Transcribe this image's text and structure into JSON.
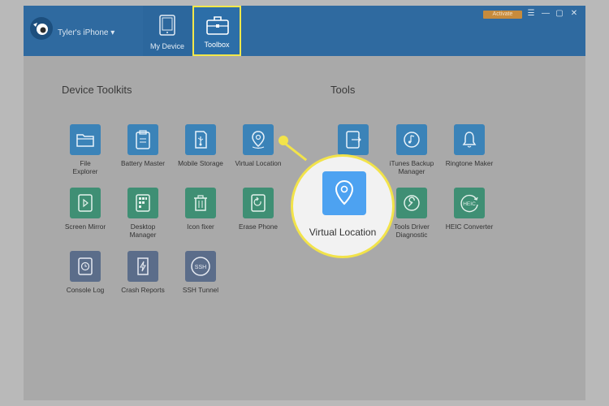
{
  "header": {
    "device_name": "Tyler's iPhone ▾",
    "tabs": [
      {
        "label": "My Device",
        "icon": "tablet-icon"
      },
      {
        "label": "Toolbox",
        "icon": "briefcase-icon",
        "selected": true,
        "highlight_color": "#f2e84a"
      }
    ],
    "activate_label": "Activate",
    "window_controls": {
      "menu": "☰",
      "minimize": "—",
      "maximize": "▢",
      "close": "✕"
    },
    "bg_color": "#2f6aa0"
  },
  "sections": {
    "device_toolkits": "Device Toolkits",
    "tools": "Tools"
  },
  "device_toolkits": [
    {
      "label": "File Explorer",
      "icon": "folder-icon",
      "color": "blue"
    },
    {
      "label": "Battery Master",
      "icon": "clipboard-icon",
      "color": "blue"
    },
    {
      "label": "Mobile Storage",
      "icon": "usb-icon",
      "color": "blue"
    },
    {
      "label": "Virtual Location",
      "icon": "location-pin-icon",
      "color": "blue"
    },
    {
      "label": "Screen Mirror",
      "icon": "play-icon",
      "color": "green"
    },
    {
      "label": "Desktop Manager",
      "icon": "grid-icon",
      "color": "green"
    },
    {
      "label": "Icon fixer",
      "icon": "trash-icon",
      "color": "green"
    },
    {
      "label": "Erase Phone",
      "icon": "phone-reset-icon",
      "color": "green"
    },
    {
      "label": "Console Log",
      "icon": "clock-icon",
      "color": "slate"
    },
    {
      "label": "Crash Reports",
      "icon": "lightning-icon",
      "color": "slate"
    },
    {
      "label": "SSH Tunnel",
      "icon": "ssh-icon",
      "color": "slate"
    }
  ],
  "tools": [
    {
      "label": "",
      "icon": "transfer-icon",
      "color": "blue"
    },
    {
      "label": "iTunes Backup Manager",
      "icon": "music-sync-icon",
      "color": "blue"
    },
    {
      "label": "Ringtone Maker",
      "icon": "bell-icon",
      "color": "blue"
    },
    {
      "label": "Tools Driver Diagnostic",
      "icon": "wrench-icon",
      "color": "green"
    },
    {
      "label": "HEIC Converter",
      "icon": "heic-icon",
      "color": "green"
    }
  ],
  "callout": {
    "label": "Virtual Location",
    "icon": "location-pin-icon",
    "accent_color": "#f2e34a",
    "icon_color": "#4da2f1"
  }
}
